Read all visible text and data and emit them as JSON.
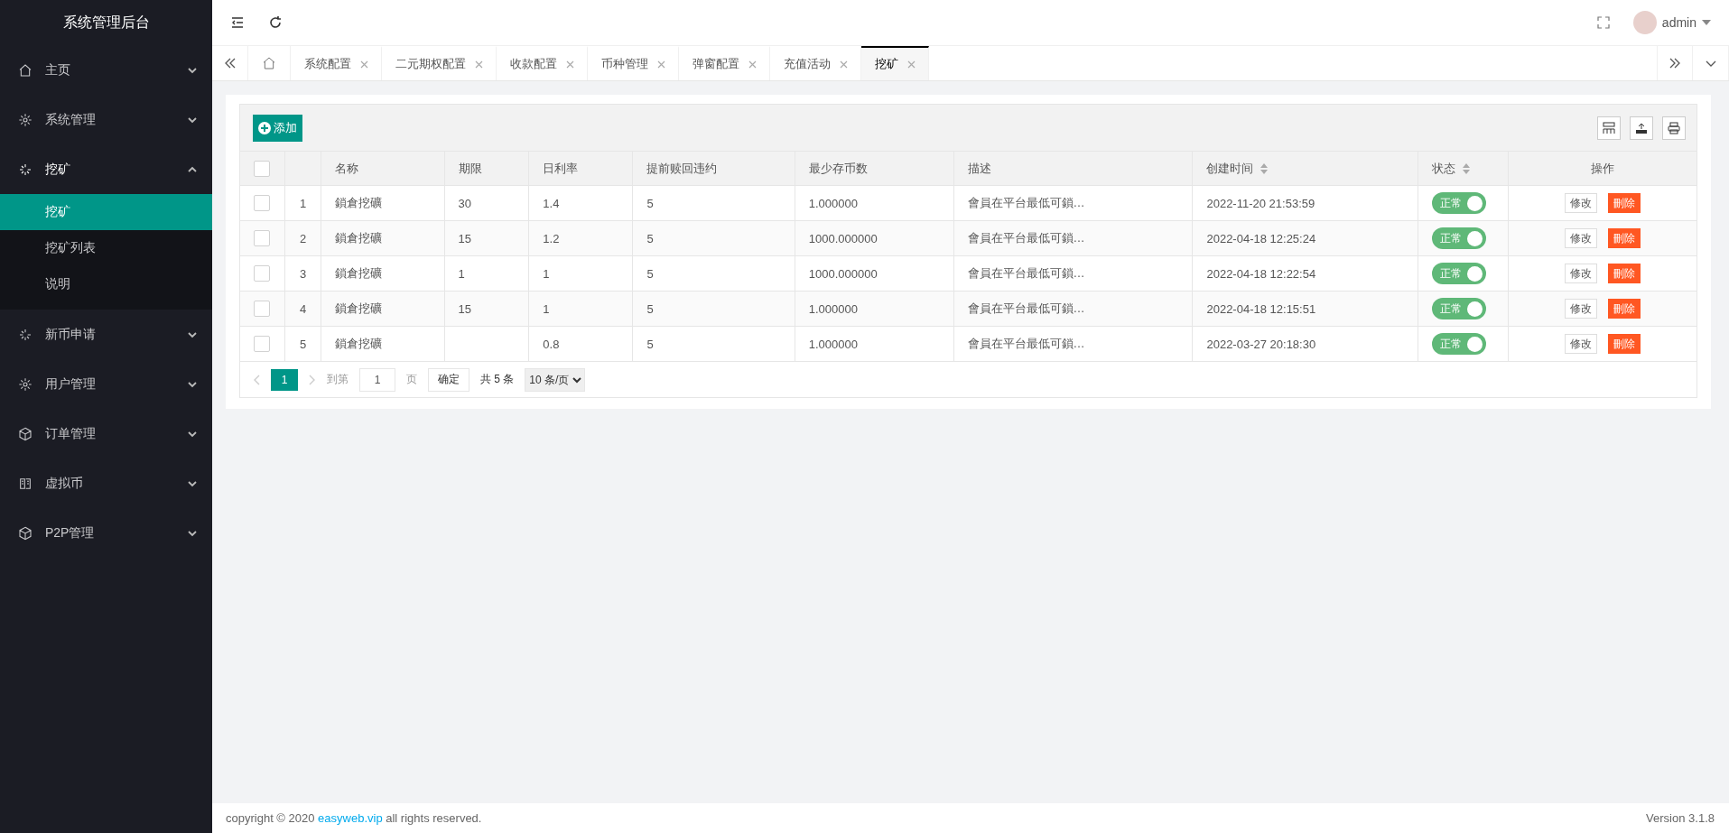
{
  "sidebar": {
    "title": "系统管理后台",
    "items": [
      {
        "label": "主页",
        "kind": "home",
        "expanded": false
      },
      {
        "label": "系统管理",
        "kind": "gear",
        "expanded": false
      },
      {
        "label": "挖矿",
        "kind": "spark",
        "expanded": true,
        "children": [
          {
            "label": "挖矿",
            "selected": true
          },
          {
            "label": "挖矿列表",
            "selected": false
          },
          {
            "label": "说明",
            "selected": false
          }
        ]
      },
      {
        "label": "新币申请",
        "kind": "spark",
        "expanded": false
      },
      {
        "label": "用户管理",
        "kind": "gear",
        "expanded": false
      },
      {
        "label": "订单管理",
        "kind": "cube",
        "expanded": false
      },
      {
        "label": "虚拟币",
        "kind": "book",
        "expanded": false
      },
      {
        "label": "P2P管理",
        "kind": "cube",
        "expanded": false
      }
    ]
  },
  "header": {
    "user": "admin"
  },
  "tabs": [
    {
      "label": "系统配置",
      "selected": false
    },
    {
      "label": "二元期权配置",
      "selected": false
    },
    {
      "label": "收款配置",
      "selected": false
    },
    {
      "label": "币种管理",
      "selected": false
    },
    {
      "label": "弹窗配置",
      "selected": false
    },
    {
      "label": "充值活动",
      "selected": false
    },
    {
      "label": "挖矿",
      "selected": true
    }
  ],
  "toolbar": {
    "add_button": "添加"
  },
  "table": {
    "select_all_checked": false,
    "columns": [
      {
        "label": "名称",
        "sortable": false
      },
      {
        "label": "期限",
        "sortable": false
      },
      {
        "label": "日利率",
        "sortable": false
      },
      {
        "label": "提前赎回违约",
        "sortable": false
      },
      {
        "label": "最少存币数",
        "sortable": false
      },
      {
        "label": "描述",
        "sortable": false
      },
      {
        "label": "创建时间",
        "sortable": true
      },
      {
        "label": "状态",
        "sortable": true
      },
      {
        "label": "操作",
        "sortable": false
      }
    ],
    "rows": [
      {
        "index": "1",
        "checked": false,
        "name": "鎖倉挖礦",
        "term": "30",
        "rate": "1.4",
        "penalty": "5",
        "min": "1.000000",
        "desc": "會員在平台最低可鎖…",
        "created": "2022-11-20 21:53:59",
        "status": "正常",
        "on": true,
        "edit": "修改",
        "delete": "刪除"
      },
      {
        "index": "2",
        "checked": false,
        "name": "鎖倉挖礦",
        "term": "15",
        "rate": "1.2",
        "penalty": "5",
        "min": "1000.000000",
        "desc": "會員在平台最低可鎖…",
        "created": "2022-04-18 12:25:24",
        "status": "正常",
        "on": true,
        "edit": "修改",
        "delete": "刪除"
      },
      {
        "index": "3",
        "checked": false,
        "name": "鎖倉挖礦",
        "term": "1",
        "rate": "1",
        "penalty": "5",
        "min": "1000.000000",
        "desc": "會員在平台最低可鎖…",
        "created": "2022-04-18 12:22:54",
        "status": "正常",
        "on": true,
        "edit": "修改",
        "delete": "刪除"
      },
      {
        "index": "4",
        "checked": false,
        "name": "鎖倉挖礦",
        "term": "15",
        "rate": "1",
        "penalty": "5",
        "min": "1.000000",
        "desc": "會員在平台最低可鎖…",
        "created": "2022-04-18 12:15:51",
        "status": "正常",
        "on": true,
        "edit": "修改",
        "delete": "刪除"
      },
      {
        "index": "5",
        "checked": false,
        "name": "鎖倉挖礦",
        "rate": "0.8",
        "penalty": "5",
        "min": "1.000000",
        "desc": "會員在平台最低可鎖…",
        "created": "2022-03-27 20:18:30",
        "status": "正常",
        "on": true,
        "edit": "修改",
        "delete": "刪除"
      }
    ]
  },
  "pagination": {
    "current": "1",
    "goto_label": "到第",
    "goto_value": "1",
    "page_label": "页",
    "confirm": "确定",
    "total": "共 5 条",
    "page_size": "10 条/页"
  },
  "footer": {
    "copyright_prefix": "copyright © 2020 ",
    "link": "easyweb.vip",
    "copyright_suffix": " all rights reserved.",
    "version": "Version 3.1.8"
  }
}
